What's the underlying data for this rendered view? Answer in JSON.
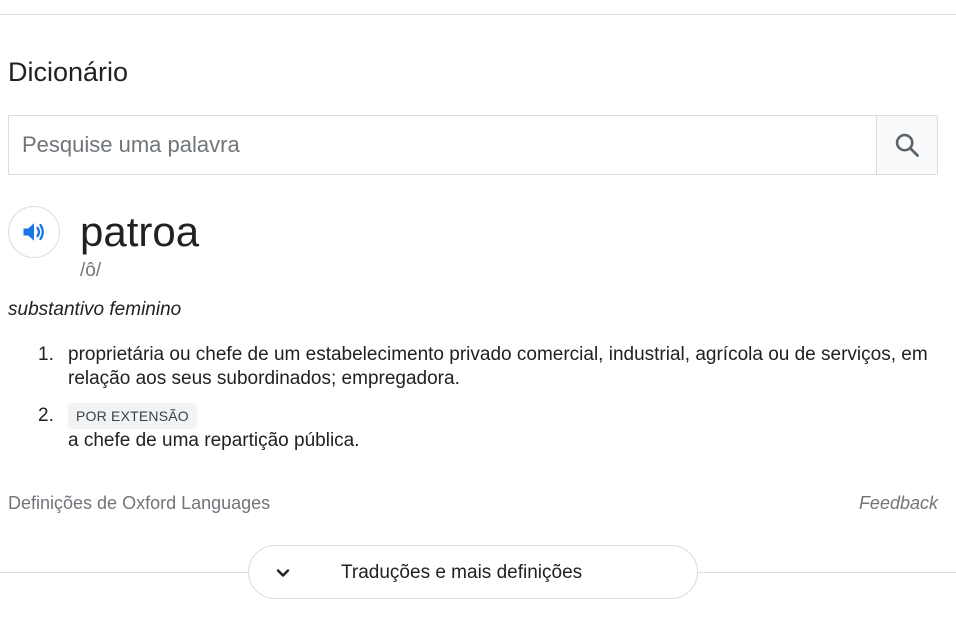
{
  "dictionary": {
    "title": "Dicionário",
    "search": {
      "placeholder": "Pesquise uma palavra",
      "value": ""
    },
    "entry": {
      "headword": "patroa",
      "phonetic": "/ô/",
      "part_of_speech": "substantivo feminino",
      "definitions": [
        {
          "number": "1.",
          "text": "proprietária ou chefe de um estabelecimento privado comercial, industrial, agrícola ou de serviços, em relação aos seus subordinados; empregadora."
        },
        {
          "number": "2.",
          "label": "POR EXTENSÃO",
          "text": "a chefe de uma repartição pública."
        }
      ]
    },
    "source": "Definições de Oxford Languages",
    "feedback": "Feedback",
    "more_button": "Traduções e mais definições"
  },
  "icons": {
    "search": "search-icon",
    "speaker": "speaker-icon",
    "expand": "chevron-down-icon"
  },
  "colors": {
    "speaker_blue": "#1a73e8",
    "muted_text": "#70757a",
    "border": "#dadce0"
  }
}
